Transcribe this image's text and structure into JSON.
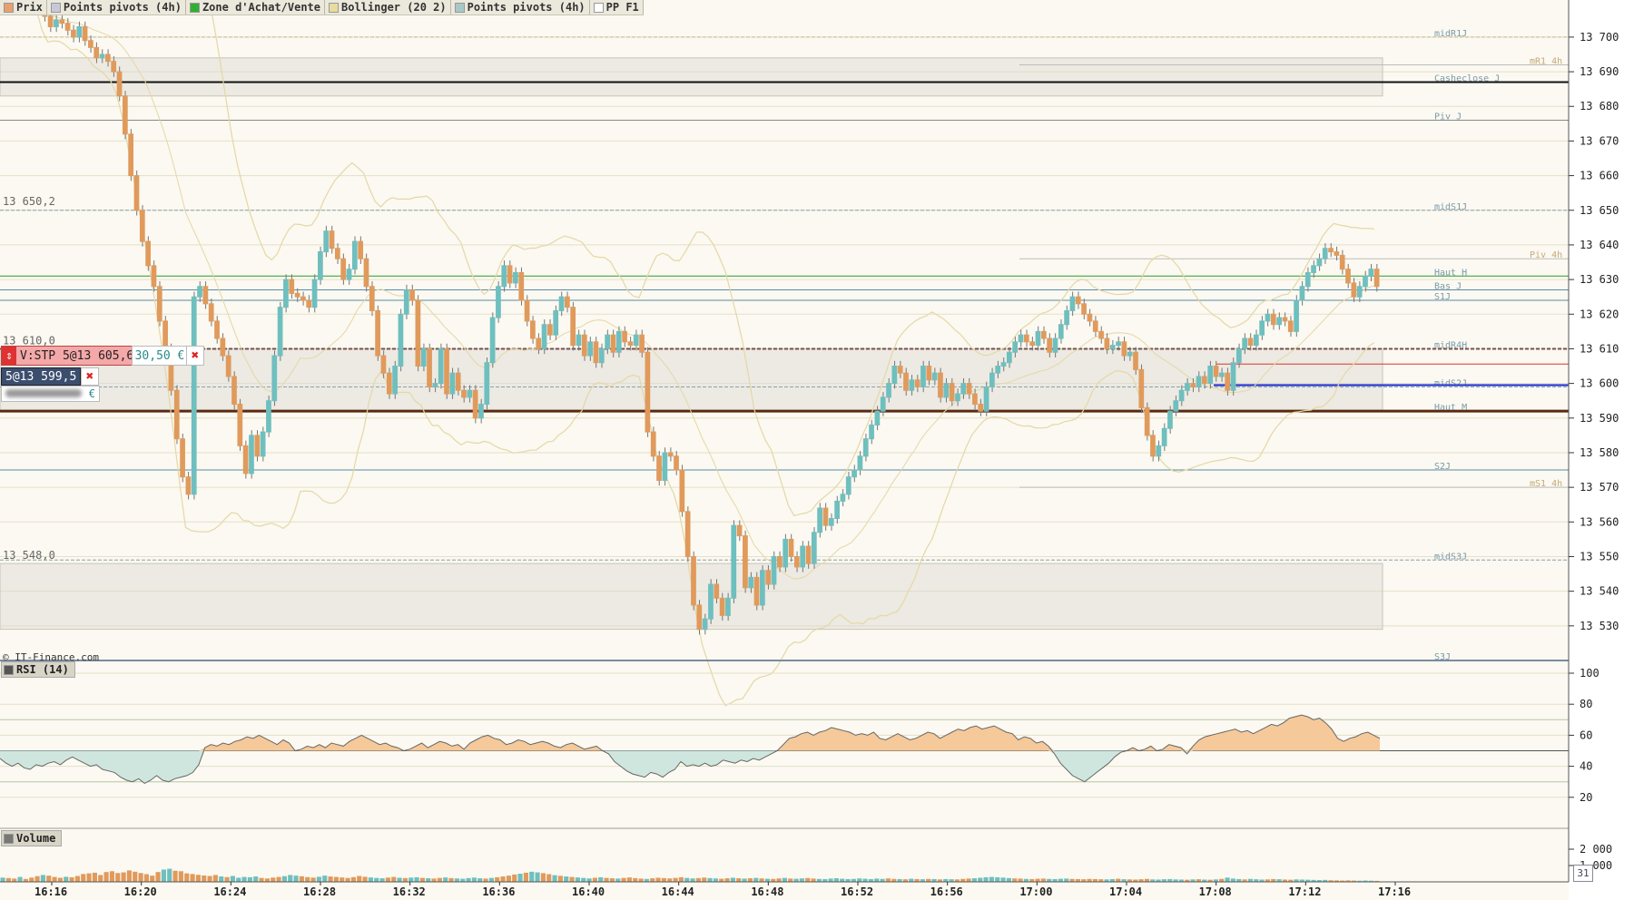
{
  "legend": [
    {
      "label": "Prix",
      "color": "#e8a070"
    },
    {
      "label": "Points pivots (4h)",
      "color": "#c8c8d8"
    },
    {
      "label": "Zone d'Achat/Vente",
      "color": "#30b030"
    },
    {
      "label": "Bollinger (20 2)",
      "color": "#e8dca0"
    },
    {
      "label": "Points pivots (4h)",
      "color": "#a8c8c8"
    },
    {
      "label": "PP F1",
      "color": "#ffffff"
    }
  ],
  "order": {
    "label": "V:STP 5@13 605,6",
    "pnl": "30,50 €",
    "close_icon": "close-icon"
  },
  "position": {
    "label": "5@13 599,5",
    "euro": "€"
  },
  "copyright": "© IT-Finance.com",
  "rsi_label": "RSI (14)",
  "volume_label": "Volume",
  "calendar_label": "31",
  "colors": {
    "up": "#6fbfbf",
    "down": "#e09a5c",
    "bollinger": "#e5d7a6",
    "background": "#fbf9f1"
  },
  "chart_data": [
    {
      "type": "candlestick",
      "title": "Prix",
      "ylim": [
        13520,
        13706
      ],
      "yticks": [
        13530,
        13540,
        13550,
        13560,
        13570,
        13580,
        13590,
        13600,
        13610,
        13620,
        13630,
        13640,
        13650,
        13660,
        13670,
        13680,
        13690,
        13700
      ],
      "ytick_labels": [
        "13 530",
        "13 540",
        "13 550",
        "13 560",
        "13 570",
        "13 580",
        "13 590",
        "13 600",
        "13 610",
        "13 620",
        "13 630",
        "13 640",
        "13 650",
        "13 660",
        "13 670",
        "13 680",
        "13 690",
        "13 700"
      ],
      "xticks": [
        "16:16",
        "16:20",
        "16:24",
        "16:28",
        "16:32",
        "16:36",
        "16:40",
        "16:44",
        "16:48",
        "16:52",
        "16:56",
        "17:00",
        "17:04",
        "17:08",
        "17:12",
        "17:16"
      ],
      "time_start": "16:14",
      "minutes_per_bar": 0.25,
      "close": [
        13710,
        13706,
        13703,
        13705,
        13704,
        13702,
        13700,
        13703,
        13699,
        13697,
        13694,
        13695,
        13693,
        13690,
        13683,
        13672,
        13660,
        13650,
        13641,
        13634,
        13628,
        13618,
        13610,
        13598,
        13584,
        13573,
        13568,
        13625,
        13628,
        13623,
        13618,
        13613,
        13608,
        13602,
        13594,
        13582,
        13574,
        13585,
        13579,
        13586,
        13595,
        13608,
        13622,
        13630,
        13626,
        13625,
        13624,
        13622,
        13630,
        13638,
        13644,
        13639,
        13636,
        13630,
        13633,
        13641,
        13636,
        13628,
        13621,
        13608,
        13603,
        13597,
        13605,
        13620,
        13627,
        13624,
        13605,
        13610,
        13599,
        13600,
        13610,
        13597,
        13603,
        13598,
        13596,
        13598,
        13590,
        13594,
        13606,
        13619,
        13628,
        13634,
        13629,
        13632,
        13624,
        13618,
        13613,
        13610,
        13617,
        13614,
        13621,
        13625,
        13622,
        13611,
        13614,
        13608,
        13612,
        13606,
        13610,
        13614,
        13609,
        13615,
        13612,
        13611,
        13614,
        13609,
        13586,
        13579,
        13572,
        13580,
        13579,
        13575,
        13563,
        13550,
        13536,
        13529,
        13532,
        13542,
        13538,
        13533,
        13538,
        13559,
        13556,
        13541,
        13544,
        13536,
        13546,
        13542,
        13550,
        13547,
        13555,
        13550,
        13547,
        13553,
        13548,
        13557,
        13564,
        13559,
        13561,
        13566,
        13568,
        13573,
        13575,
        13579,
        13584,
        13588,
        13592,
        13596,
        13600,
        13605,
        13603,
        13598,
        13601,
        13599,
        13605,
        13601,
        13603,
        13596,
        13600,
        13595,
        13597,
        13600,
        13597,
        13594,
        13592,
        13599,
        13603,
        13605,
        13606,
        13609,
        13612,
        13614,
        13612,
        13611,
        13615,
        13613,
        13609,
        13613,
        13617,
        13621,
        13625,
        13623,
        13620,
        13618,
        13615,
        13613,
        13610,
        13611,
        13612,
        13608,
        13609,
        13604,
        13593,
        13585,
        13579,
        13582,
        13587,
        13592,
        13595,
        13598,
        13600,
        13599,
        13602,
        13600,
        13605,
        13602,
        13603,
        13598,
        13606,
        13610,
        13613,
        13611,
        13614,
        13618,
        13620,
        13617,
        13619,
        13618,
        13615,
        13624,
        13628,
        13632,
        13634,
        13636,
        13639,
        13638,
        13637,
        13633,
        13629,
        13625,
        13628,
        13631,
        13633,
        13628
      ],
      "bands_mid": 13610,
      "horizontal_lines": [
        {
          "label": "midR1J",
          "value": 13700
        },
        {
          "label": "mR1 4h",
          "value": 13692
        },
        {
          "label": "Casheclose J",
          "value": 13687
        },
        {
          "label": "Piv J",
          "value": 13676
        },
        {
          "label": "midS1J",
          "value": 13650
        },
        {
          "label": "Piv 4h",
          "value": 13636
        },
        {
          "label": "Haut H",
          "value": 13631
        },
        {
          "label": "Bas J",
          "value": 13627
        },
        {
          "label": "S1J",
          "value": 13624
        },
        {
          "label": "midR4H",
          "value": 13610
        },
        {
          "label": "midS2J",
          "value": 13599
        },
        {
          "label": "Haut M",
          "value": 13592
        },
        {
          "label": "S2J",
          "value": 13575
        },
        {
          "label": "mS1 4h",
          "value": 13570
        },
        {
          "label": "midS3J",
          "value": 13549
        },
        {
          "label": "S3J",
          "value": 13520
        }
      ],
      "price_labels": [
        "13 650,2",
        "13 610,0",
        "13 548,0"
      ],
      "price_label_values": [
        13650.2,
        13610.0,
        13548.0
      ]
    },
    {
      "type": "line",
      "title": "RSI (14)",
      "ylim": [
        0,
        100
      ],
      "yticks": [
        20,
        40,
        60,
        80,
        100
      ],
      "ytick_labels": [
        "20",
        "40",
        "60",
        "80",
        "100"
      ],
      "reference_lines": [
        30,
        50,
        70
      ],
      "values": [
        45,
        42,
        40,
        42,
        39,
        38,
        41,
        40,
        42,
        43,
        41,
        44,
        46,
        44,
        42,
        40,
        41,
        38,
        37,
        36,
        33,
        31,
        30,
        32,
        29,
        31,
        34,
        31,
        30,
        32,
        33,
        34,
        36,
        41,
        52,
        54,
        53,
        55,
        54,
        56,
        57,
        59,
        58,
        60,
        58,
        56,
        54,
        57,
        55,
        50,
        51,
        53,
        52,
        54,
        52,
        55,
        54,
        53,
        56,
        58,
        60,
        58,
        56,
        54,
        55,
        53,
        52,
        50,
        51,
        53,
        55,
        52,
        54,
        56,
        55,
        53,
        54,
        51,
        55,
        57,
        59,
        60,
        58,
        57,
        54,
        55,
        57,
        56,
        54,
        55,
        56,
        55,
        53,
        52,
        54,
        55,
        53,
        51,
        52,
        53,
        50,
        48,
        43,
        40,
        37,
        35,
        34,
        33,
        36,
        35,
        33,
        36,
        38,
        43,
        40,
        41,
        40,
        42,
        40,
        41,
        44,
        43,
        42,
        44,
        43,
        45,
        44,
        46,
        48,
        50,
        54,
        58,
        59,
        61,
        62,
        60,
        62,
        63,
        65,
        64,
        63,
        62,
        60,
        61,
        60,
        62,
        58,
        57,
        59,
        61,
        59,
        57,
        58,
        60,
        62,
        61,
        58,
        60,
        62,
        64,
        63,
        65,
        66,
        64,
        65,
        66,
        64,
        62,
        61,
        57,
        59,
        58,
        55,
        56,
        53,
        48,
        42,
        38,
        34,
        32,
        30,
        33,
        36,
        39,
        42,
        46,
        49,
        50,
        52,
        50,
        51,
        53,
        50,
        51,
        54,
        53,
        52,
        48,
        53,
        57,
        59,
        60,
        61,
        62,
        63,
        64,
        62,
        63,
        61,
        63,
        65,
        67,
        66,
        68,
        71,
        72,
        73,
        72,
        70,
        71,
        68,
        64,
        58,
        56,
        58,
        59,
        61,
        62,
        60,
        58
      ]
    },
    {
      "type": "bar",
      "title": "Volume",
      "yticks": [
        1000,
        2000
      ],
      "ytick_labels": [
        "1 000",
        "2 000"
      ],
      "ylim": [
        0,
        3000
      ],
      "values": [
        260,
        230,
        200,
        300,
        180,
        260,
        350,
        420,
        380,
        300,
        250,
        310,
        280,
        360,
        480,
        520,
        560,
        420,
        600,
        650,
        540,
        580,
        700,
        620,
        540,
        470,
        380,
        600,
        750,
        800,
        680,
        650,
        520,
        480,
        430,
        390,
        360,
        420,
        330,
        290,
        360,
        250,
        300,
        280,
        330,
        240,
        210,
        260,
        300,
        350,
        420,
        380,
        340,
        290,
        260,
        310,
        380,
        330,
        300,
        270,
        240,
        290,
        360,
        310,
        270,
        240,
        220,
        260,
        300,
        250,
        230,
        260,
        280,
        240,
        220,
        200,
        240,
        270,
        230,
        210,
        190,
        230,
        260,
        220,
        200,
        240,
        280,
        330,
        380,
        450,
        500,
        560,
        620,
        580,
        530,
        470,
        410,
        370,
        330,
        300,
        270,
        240,
        210,
        250,
        280,
        240,
        220,
        200,
        240,
        270,
        230,
        200,
        180,
        220,
        250,
        230,
        210,
        240,
        280,
        240,
        210,
        230,
        260,
        230,
        210,
        190,
        220,
        250,
        220,
        200,
        220,
        240,
        210,
        190,
        180,
        210,
        240,
        200,
        190,
        210,
        230,
        200,
        180,
        170,
        200,
        220,
        190,
        170,
        180,
        210,
        190,
        170,
        200,
        180,
        210,
        180,
        170,
        160,
        190,
        170,
        160,
        180,
        170,
        150,
        170,
        160,
        150,
        180,
        200,
        220,
        250,
        280,
        300,
        280,
        260,
        230,
        210,
        200,
        180,
        170,
        190,
        200,
        180,
        170,
        190,
        200,
        180,
        170,
        160,
        180,
        170,
        160,
        150,
        170,
        190,
        160,
        150,
        140,
        160,
        180,
        150,
        140,
        160,
        170,
        150,
        140,
        130,
        150,
        160,
        140,
        130,
        150,
        180,
        260,
        200,
        170,
        150,
        180,
        160,
        140,
        150,
        170,
        160,
        140,
        130,
        150,
        140,
        130,
        120,
        110,
        120,
        100,
        90,
        80,
        90,
        80,
        70,
        80,
        70,
        60
      ],
      "colors_by_sign": true
    }
  ]
}
